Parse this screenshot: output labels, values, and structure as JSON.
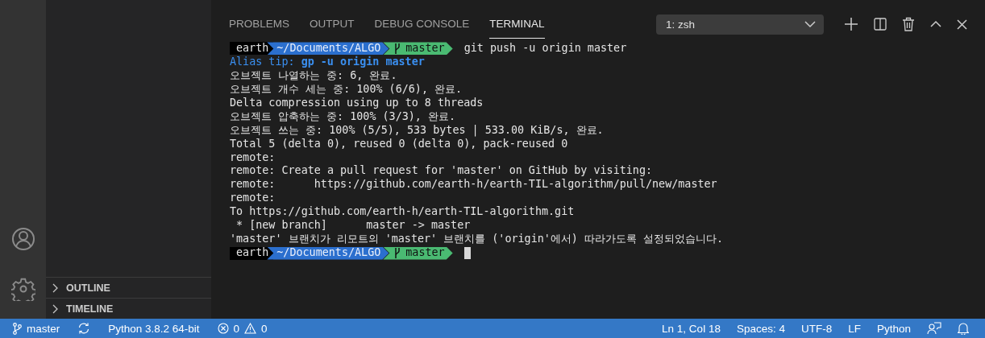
{
  "sidebar": {
    "sections": [
      {
        "label": "OUTLINE",
        "expanded": false
      },
      {
        "label": "TIMELINE",
        "expanded": false
      }
    ]
  },
  "panel": {
    "tabs": [
      {
        "label": "PROBLEMS",
        "selected": false
      },
      {
        "label": "OUTPUT",
        "selected": false
      },
      {
        "label": "DEBUG CONSOLE",
        "selected": false
      },
      {
        "label": "TERMINAL",
        "selected": true
      }
    ],
    "terminal_select": {
      "value": "1: zsh"
    }
  },
  "terminal": {
    "lines": [
      {
        "kind": "prompt",
        "user": "earth",
        "path": "~/Documents/ALGO",
        "branch": "master",
        "command": "git push -u origin master"
      },
      {
        "kind": "tip",
        "label": "Alias tip:",
        "text": "gp -u origin master"
      },
      {
        "kind": "output",
        "text": "오브젝트 나열하는 중: 6, 완료."
      },
      {
        "kind": "output",
        "text": "오브젝트 개수 세는 중: 100% (6/6), 완료."
      },
      {
        "kind": "output",
        "text": "Delta compression using up to 8 threads"
      },
      {
        "kind": "output",
        "text": "오브젝트 압축하는 중: 100% (3/3), 완료."
      },
      {
        "kind": "output",
        "text": "오브젝트 쓰는 중: 100% (5/5), 533 bytes | 533.00 KiB/s, 완료."
      },
      {
        "kind": "output",
        "text": "Total 5 (delta 0), reused 0 (delta 0), pack-reused 0"
      },
      {
        "kind": "output",
        "text": "remote:"
      },
      {
        "kind": "output",
        "text": "remote: Create a pull request for 'master' on GitHub by visiting:"
      },
      {
        "kind": "output",
        "text": "remote:      https://github.com/earth-h/earth-TIL-algorithm/pull/new/master"
      },
      {
        "kind": "output",
        "text": "remote:"
      },
      {
        "kind": "output",
        "text": "To https://github.com/earth-h/earth-TIL-algorithm.git"
      },
      {
        "kind": "output",
        "text": " * [new branch]      master -> master"
      },
      {
        "kind": "output",
        "text": "'master' 브랜치가 리모트의 'master' 브랜치를 ('origin'에서) 따라가도록 설정되었습니다."
      },
      {
        "kind": "prompt",
        "user": "earth",
        "path": "~/Documents/ALGO",
        "branch": "master",
        "cursor": true
      }
    ]
  },
  "status_bar": {
    "branch": "master",
    "interpreter": "Python 3.8.2 64-bit",
    "errors": "0",
    "warnings": "0",
    "position": "Ln 1, Col 18",
    "indent": "Spaces: 4",
    "encoding": "UTF-8",
    "eol": "LF",
    "language": "Python"
  }
}
